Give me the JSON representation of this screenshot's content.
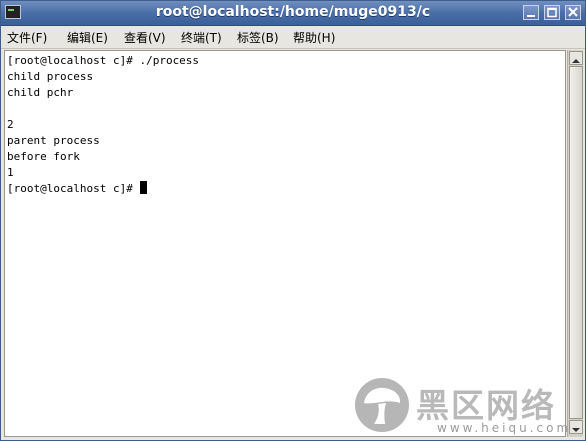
{
  "window": {
    "title": "root@localhost:/home/muge0913/c",
    "icon": "terminal-icon",
    "controls": [
      "minimize-icon",
      "maximize-icon",
      "close-icon"
    ]
  },
  "menu": {
    "items": [
      "文件(F)",
      "编辑(E)",
      "查看(V)",
      "终端(T)",
      "标签(B)",
      "帮助(H)"
    ]
  },
  "terminal": {
    "lines": [
      "[root@localhost c]# ./process",
      "child process",
      "child pchr",
      "",
      "2",
      "parent process",
      "before fork",
      "1",
      "[root@localhost c]# "
    ],
    "cursor": "block"
  },
  "watermark": {
    "text": "黑区网络",
    "domain": "www.heiqu.com"
  }
}
